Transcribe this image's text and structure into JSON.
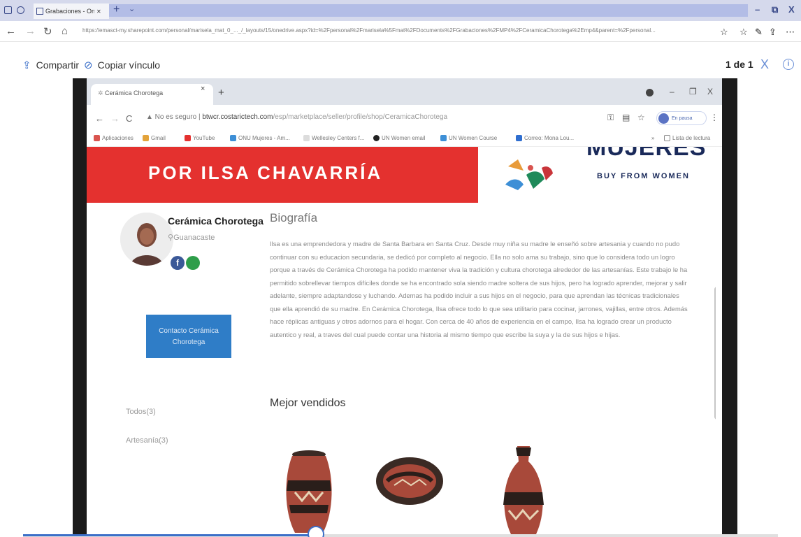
{
  "edge": {
    "tab_title": "Grabaciones - OneDrive",
    "tab_close": "✕",
    "tab_new": "+",
    "url": "https://emasct-my.sharepoint.com/personal/marisela_mat_0_..._/_layouts/15/onedrive.aspx?id=%2Fpersonal%2Fmarisela%5Fmat%2FDocuments%2FGrabaciones%2FMP4%2FCeramicaChorotega%2Emp4&parent=%2Fpersonal...",
    "window_minimize": "–",
    "window_close": "X"
  },
  "onedrive": {
    "share_label": "Compartir",
    "copy_link_label": "Copiar vínculo",
    "page_counter": "1 de 1",
    "close_label": "X",
    "info_label": "i"
  },
  "chrome": {
    "tab_title": "Cerámica Chorotega",
    "tab_close": "×",
    "new_tab": "+",
    "win_min": "–",
    "win_max": "❐",
    "win_close": "X",
    "not_secure": "▲ No es seguro",
    "url_domain": "btwcr.costarictech.com",
    "url_path": "/esp/marketplace/seller/profile/shop/CeramicaChorotega",
    "profile_label": "En pausa",
    "menu_label": "⋮",
    "bookmarks": [
      "Aplicaciones",
      "Gmail",
      "YouTube",
      "ONU Mujeres - Am...",
      "Wellesley Centers f...",
      "UN Women email",
      "UN Women Course",
      "Correo: Mona Lou..."
    ],
    "bm_more": "»",
    "reading_list": "Lista de lectura"
  },
  "page": {
    "banner_text": "POR ILSA CHAVARRÍA",
    "logo_main": "MUJERES",
    "logo_sub": "BUY FROM WOMEN",
    "seller_name": "Cerámica Chorotega",
    "seller_location": "Guanacaste",
    "facebook_letter": "f",
    "contact_button": "Contacto Cerámica Chorotega",
    "bio_title": "Biografía",
    "bio_text": "Ilsa es una emprendedora y madre de Santa Barbara en Santa Cruz. Desde muy niña su madre le enseñó sobre artesania y cuando no pudo continuar con su educacion secundaria, se dedicó por completo al negocio. Ella no solo ama su trabajo, sino que lo considera todo un logro porque a través de Cerámica Chorotega ha podido mantener viva la tradición y cultura chorotega alrededor de las artesanías. Este trabajo le ha permitido sobrellevar tiempos difíciles donde se ha encontrado sola siendo madre soltera de sus hijos, pero ha logrado aprender, mejorar y salir adelante, siempre adaptandose y luchando. Ademas ha podido incluir a sus hijos en el negocio, para que aprendan las técnicas tradicionales que ella aprendió de su madre. En Cerámica Chorotega, Ilsa ofrece todo lo que sea utilitario para cocinar, jarrones, vajillas, entre otros. Además hace réplicas antiguas y otros adornos para el hogar. Con cerca de 40 años de experiencia en el campo, Ilsa ha logrado crear un producto autentico y real, a traves del cual puede contar una historia al mismo tiempo que escribe la suya y la de sus hijos e hijas.",
    "category_all": "Todos(3)",
    "category_crafts": "Artesanía(3)",
    "best_sellers_title": "Mejor vendidos"
  },
  "player": {
    "progress": 0.39
  },
  "colors": {
    "banner_red": "#e4312f",
    "contact_blue": "#2f7dc7",
    "onedrive_accent": "#3b6fc9",
    "logo_navy": "#1a2a5a"
  }
}
